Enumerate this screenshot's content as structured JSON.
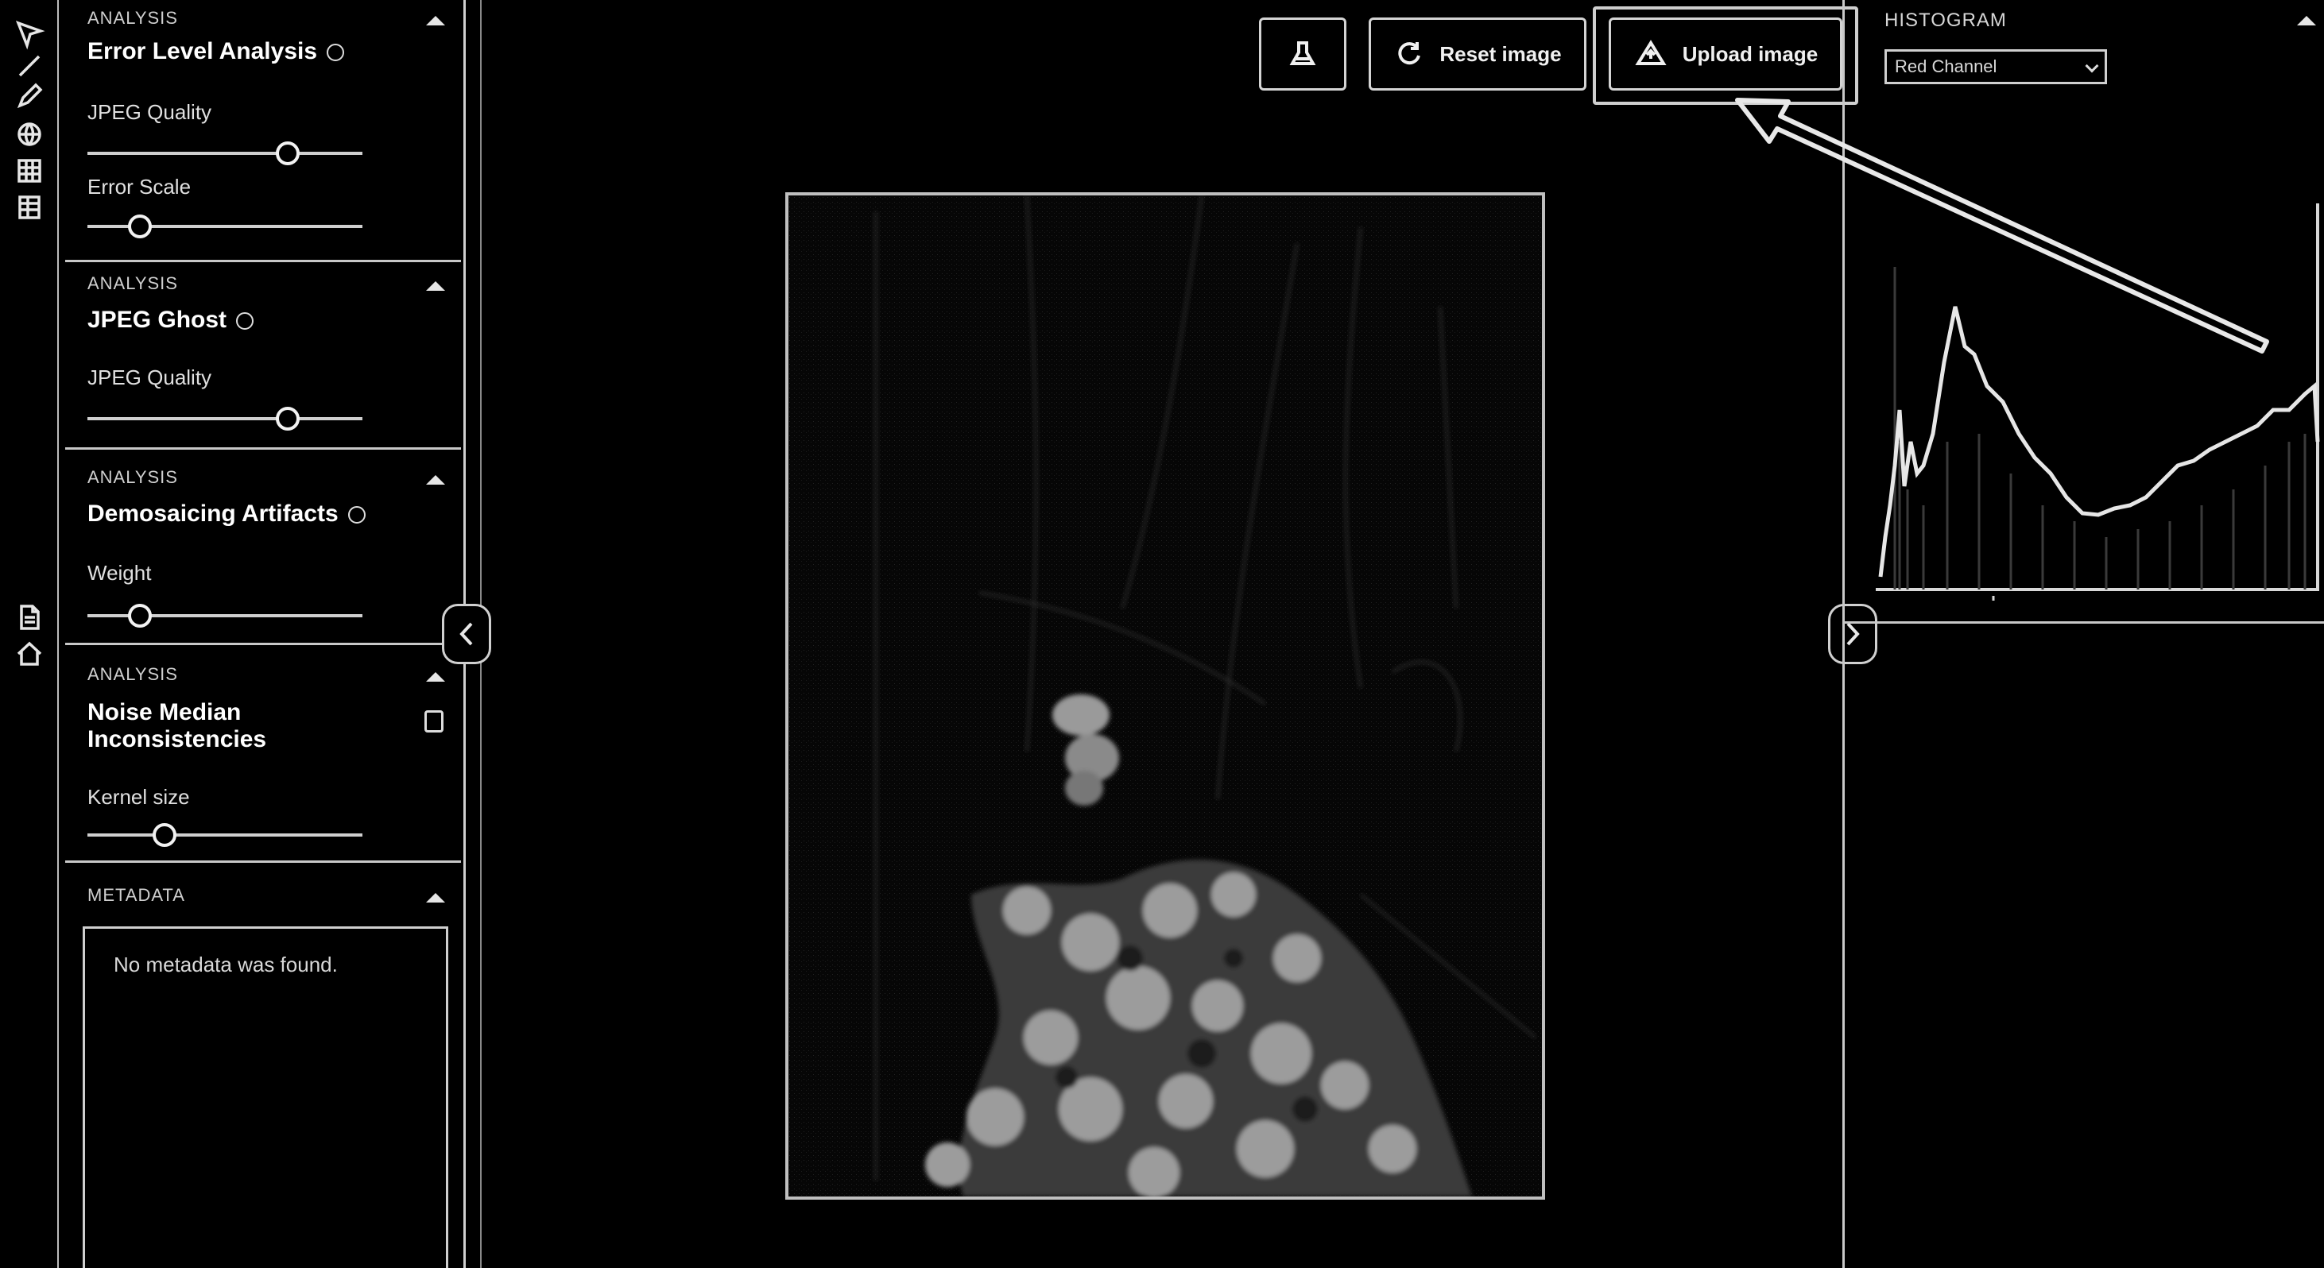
{
  "left_rail": {
    "icons": [
      "select-arrow-icon",
      "line-tool-icon",
      "pen-tool-icon",
      "globe-icon",
      "grid-icon",
      "table-icon",
      "document-icon",
      "home-icon"
    ]
  },
  "tools": {
    "sections": [
      {
        "tag": "ANALYSIS",
        "title": "Error Level Analysis",
        "params": [
          {
            "label": "JPEG Quality",
            "value": 0.75
          },
          {
            "label": "Error Scale",
            "value": 0.16
          }
        ]
      },
      {
        "tag": "ANALYSIS",
        "title": "JPEG Ghost",
        "params": [
          {
            "label": "JPEG Quality",
            "value": 0.75
          }
        ]
      },
      {
        "tag": "ANALYSIS",
        "title": "Demosaicing Artifacts",
        "params": [
          {
            "label": "Weight",
            "value": 0.16
          }
        ]
      },
      {
        "tag": "ANALYSIS",
        "title": "Noise Median Inconsistencies",
        "params": [
          {
            "label": "Kernel size",
            "value": 0.26
          }
        ]
      },
      {
        "tag": "METADATA",
        "output_text": "No metadata was found."
      }
    ]
  },
  "toolbar": {
    "settings_icon": "flask-icon",
    "reset_label": "Reset image",
    "upload_label": "Upload image"
  },
  "right_panel": {
    "tag": "HISTOGRAM",
    "channel_selected": "Red Channel"
  },
  "colors": {
    "background": "#000000",
    "foreground": "#e8e8e8"
  }
}
